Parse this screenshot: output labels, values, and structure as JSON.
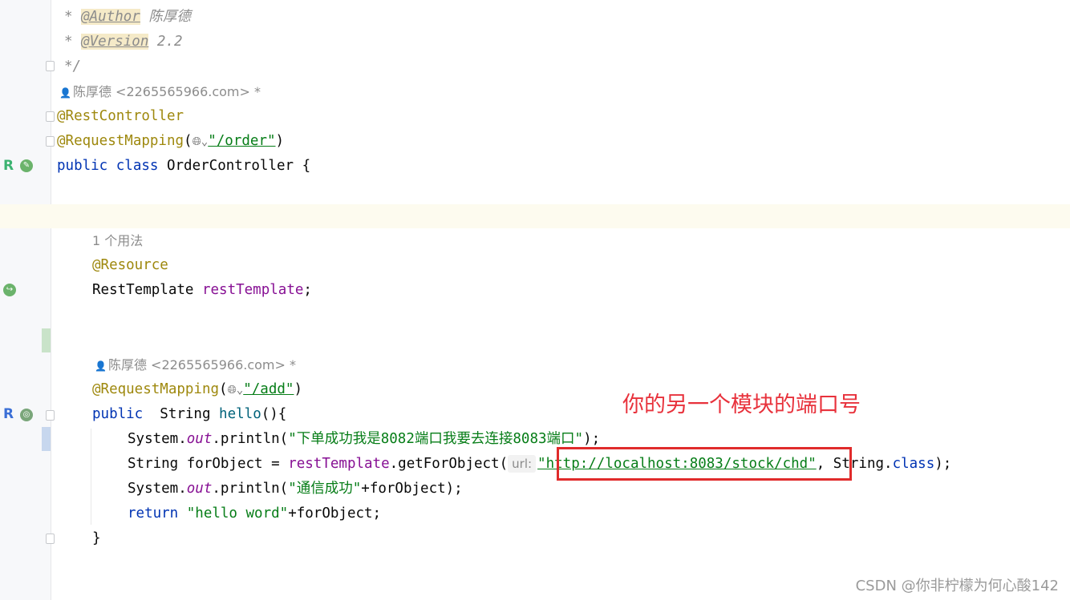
{
  "editor": {
    "doc_author_tag": "@Author",
    "doc_author_value": " 陈厚德",
    "doc_version_tag": "@Version",
    "doc_version_value": " 2.2",
    "doc_star": "* ",
    "doc_close": "*/",
    "author_hint_1": "陈厚德 <2265565966.com> *",
    "author_hint_2": "陈厚德 <2265565966.com> *",
    "ann_rest_controller": "@RestController",
    "ann_request_mapping": "@RequestMapping",
    "class_path": "\"/order\"",
    "kw_public": "public",
    "kw_class": "class",
    "class_name": " OrderController {",
    "usage_hint": "1 个用法",
    "ann_resource": "@Resource",
    "field_type": "RestTemplate ",
    "field_name": "restTemplate",
    "method_path": "\"/add\"",
    "method_sig_type": "  String ",
    "method_name": "hello",
    "method_sig_end": "(){",
    "line1_prefix": "System.",
    "line1_out": "out",
    "line1_call": ".println(",
    "line1_str": "\"下单成功我是8082端口我要去连接8083端口\"",
    "line1_end": ");",
    "line2_decl": "String forObject = ",
    "line2_field": "restTemplate",
    "line2_call": ".getForObject(",
    "param_hint_label": "url:",
    "line2_url": "\"http://localhost:8083/stock/chd\"",
    "line2_tail": ", String.",
    "line2_kw_class": "class",
    "line2_end": ");",
    "line3_prefix": "System.",
    "line3_out": "out",
    "line3_call": ".println(",
    "line3_str": "\"通信成功\"",
    "line3_end": "+forObject);",
    "kw_return": "return",
    "line4_str": " \"hello word\"",
    "line4_end": "+forObject;",
    "close_brace": "}"
  },
  "overlay": {
    "callout_text": "你的另一个模块的端口号",
    "watermark": "CSDN @你非柠檬为何心酸142",
    "highlight_color": "#e02b2b",
    "callout_color": "#e8323c"
  }
}
